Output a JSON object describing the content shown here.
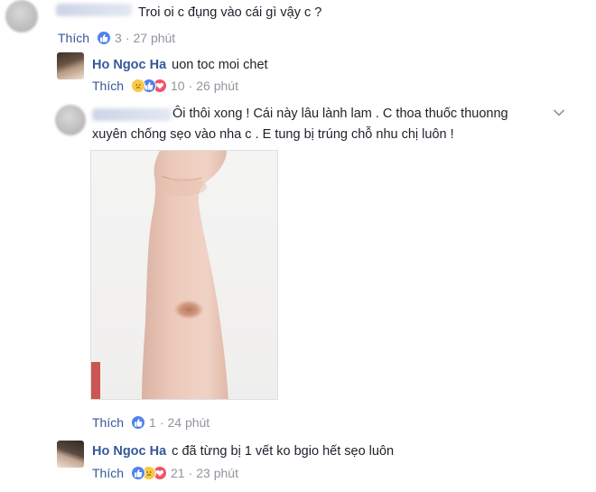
{
  "comments": [
    {
      "text": "Troi oi c đụng vào cái gì vậy c ?",
      "like_label": "Thích",
      "reaction_count": "3",
      "time": "27 phút"
    }
  ],
  "replies": [
    {
      "author": "Ho Ngoc Ha",
      "text": "uon toc moi chet",
      "like_label": "Thích",
      "reaction_count": "10",
      "time": "26 phút"
    },
    {
      "text_line1": "Ôi thôi xong ! Cái này lâu lành lam . C thoa thuốc thuonng",
      "text_line2": "xuyên chống sẹo vào nha c . E tung bị trúng chỗ nhu chị luôn !",
      "like_label": "Thích",
      "reaction_count": "1",
      "time": "24 phút"
    },
    {
      "author": "Ho Ngoc Ha",
      "text": "c đã từng bị 1 vết ko bgio hết sẹo luôn",
      "like_label": "Thích",
      "reaction_count": "21",
      "time": "23 phút"
    }
  ],
  "separator": "·",
  "colors": {
    "link": "#365899",
    "meta": "#90949c",
    "like_reaction": "#4f82ec",
    "sad_reaction": "#f7c947",
    "love_reaction": "#f25268"
  }
}
